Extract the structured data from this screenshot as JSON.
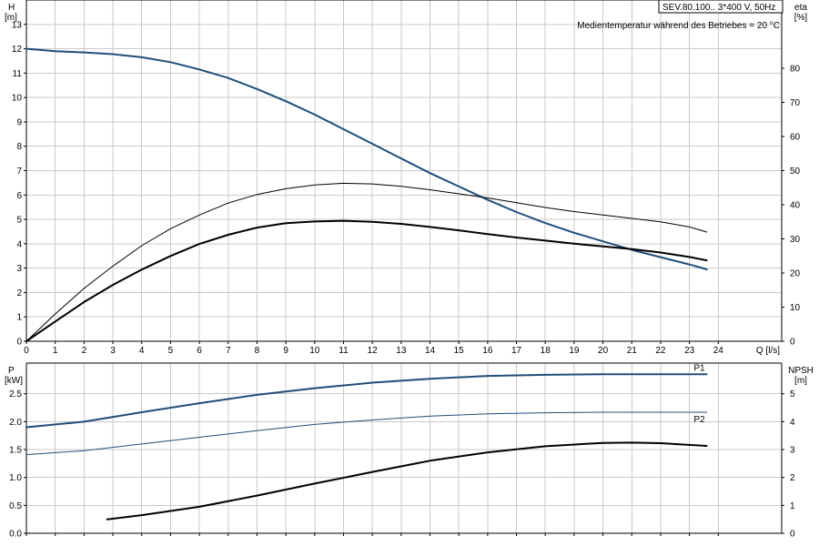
{
  "header": {
    "model": "SEV.80.100.. 3*400 V, 50Hz",
    "note": "Medientemperatur während des Betriebes = 20 °C"
  },
  "colors": {
    "blue": "#1f4e79",
    "black": "#000000",
    "grid": "#c9c9c9"
  },
  "chart_data": [
    {
      "type": "line",
      "title": "",
      "xlabel": "Q [l/s]",
      "ylabel": "H [m]",
      "y2label": "eta [%]",
      "xlabel_parts": [
        "Q",
        "[l/s]"
      ],
      "ylabel_parts": [
        "H",
        "[m]"
      ],
      "y2label_parts": [
        "eta",
        "[%]"
      ],
      "xlim": [
        0,
        26.2
      ],
      "ylim": [
        0,
        14
      ],
      "y2lim": [
        0,
        100
      ],
      "xticks": [
        0,
        1,
        2,
        3,
        4,
        5,
        6,
        7,
        8,
        9,
        10,
        11,
        12,
        13,
        14,
        15,
        16,
        17,
        18,
        19,
        20,
        21,
        22,
        23,
        24
      ],
      "yticks": [
        0,
        1,
        2,
        3,
        4,
        5,
        6,
        7,
        8,
        9,
        10,
        11,
        12,
        13
      ],
      "y2ticks": [
        0,
        10,
        20,
        30,
        40,
        50,
        60,
        70,
        80
      ],
      "grid": true,
      "series": [
        {
          "axis": "left",
          "color": "#1f4e79",
          "width": 2,
          "x": [
            0,
            1,
            2,
            3,
            4,
            5,
            6,
            7,
            8,
            9,
            10,
            11,
            12,
            13,
            14,
            15,
            16,
            17,
            18,
            19,
            20,
            21,
            22,
            23,
            23.6
          ],
          "y": [
            12.0,
            11.9,
            11.85,
            11.78,
            11.65,
            11.45,
            11.15,
            10.8,
            10.35,
            9.85,
            9.3,
            8.7,
            8.1,
            7.5,
            6.9,
            6.35,
            5.8,
            5.3,
            4.85,
            4.45,
            4.1,
            3.75,
            3.45,
            3.15,
            2.95
          ]
        },
        {
          "axis": "right",
          "color": "#000000",
          "width": 1,
          "x": [
            0,
            1,
            2,
            3,
            4,
            5,
            6,
            7,
            8,
            9,
            10,
            11,
            12,
            13,
            14,
            15,
            16,
            17,
            18,
            19,
            20,
            21,
            22,
            23,
            23.6
          ],
          "y": [
            0,
            8,
            15.5,
            22,
            28,
            33,
            37,
            40.5,
            43,
            44.7,
            45.8,
            46.3,
            46.1,
            45.4,
            44.4,
            43.2,
            42,
            40.6,
            39.2,
            38,
            37,
            36,
            35,
            33.5,
            32
          ]
        },
        {
          "axis": "right",
          "color": "#000000",
          "width": 2,
          "x": [
            0,
            1,
            2,
            3,
            4,
            5,
            6,
            7,
            8,
            9,
            10,
            11,
            12,
            13,
            14,
            15,
            16,
            17,
            18,
            19,
            20,
            21,
            22,
            23,
            23.6
          ],
          "y": [
            0,
            5.8,
            11.5,
            16.5,
            21,
            25,
            28.5,
            31.2,
            33.3,
            34.6,
            35.1,
            35.3,
            35.0,
            34.4,
            33.5,
            32.5,
            31.4,
            30.4,
            29.5,
            28.6,
            27.8,
            27.0,
            26.0,
            24.7,
            23.7
          ]
        }
      ]
    },
    {
      "type": "line",
      "title": "",
      "xlabel": "",
      "ylabel": "P [kW]",
      "y2label": "NPSH [m]",
      "ylabel_parts": [
        "P",
        "[kW]"
      ],
      "y2label_parts": [
        "NPSH",
        "[m]"
      ],
      "xlim": [
        0,
        26.2
      ],
      "ylim": [
        0,
        3.05
      ],
      "y2lim": [
        0,
        6.1
      ],
      "xticks": [
        0,
        1,
        2,
        3,
        4,
        5,
        6,
        7,
        8,
        9,
        10,
        11,
        12,
        13,
        14,
        15,
        16,
        17,
        18,
        19,
        20,
        21,
        22,
        23,
        24
      ],
      "yticks": [
        0,
        0.5,
        1.0,
        1.5,
        2.0,
        2.5
      ],
      "ytick_labels": [
        "0.0",
        "0.5",
        "1.0",
        "1.5",
        "2.0",
        "2.5"
      ],
      "y2ticks": [
        0,
        1,
        2,
        3,
        4,
        5
      ],
      "grid": true,
      "series": [
        {
          "name": "P1",
          "axis": "left",
          "color": "#1f4e79",
          "width": 2,
          "x": [
            0,
            2,
            4,
            6,
            8,
            10,
            12,
            14,
            16,
            18,
            20,
            22,
            23.6
          ],
          "y": [
            1.9,
            2.0,
            2.17,
            2.33,
            2.48,
            2.6,
            2.7,
            2.77,
            2.82,
            2.84,
            2.85,
            2.85,
            2.85
          ]
        },
        {
          "name": "P2",
          "axis": "left",
          "color": "#1f4e79",
          "width": 1,
          "x": [
            0,
            2,
            4,
            6,
            8,
            10,
            12,
            14,
            16,
            18,
            20,
            22,
            23.6
          ],
          "y": [
            1.41,
            1.48,
            1.6,
            1.72,
            1.84,
            1.95,
            2.03,
            2.1,
            2.14,
            2.16,
            2.17,
            2.17,
            2.17
          ]
        },
        {
          "axis": "right",
          "color": "#000000",
          "width": 2,
          "x": [
            2.8,
            4,
            6,
            8,
            10,
            12,
            14,
            16,
            18,
            20,
            21,
            22,
            23.6
          ],
          "y": [
            0.5,
            0.65,
            0.95,
            1.35,
            1.78,
            2.2,
            2.6,
            2.9,
            3.12,
            3.24,
            3.25,
            3.23,
            3.13
          ]
        }
      ]
    }
  ]
}
